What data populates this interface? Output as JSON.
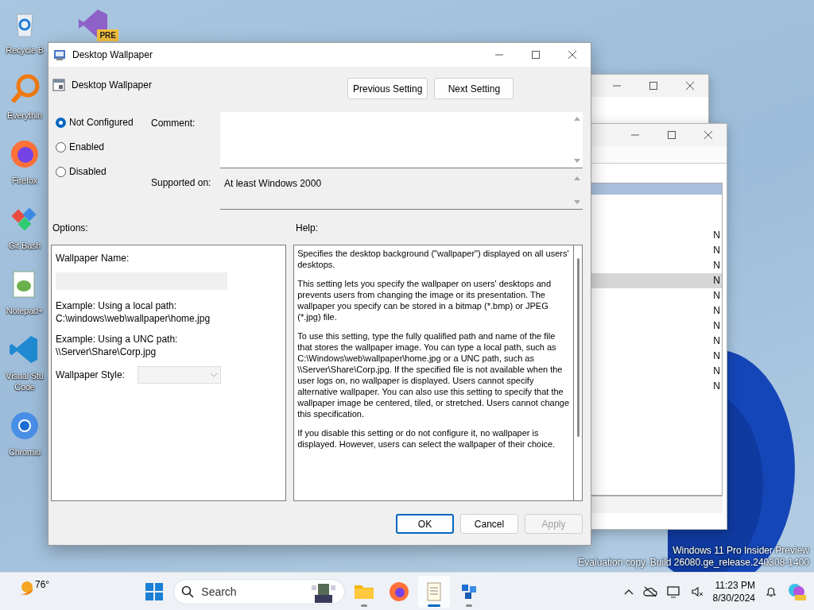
{
  "desktop_columns": [
    [
      {
        "kind": "recycle-bin",
        "label_lines": [
          "Recycle B"
        ]
      },
      {
        "kind": "magnifier-app",
        "label_lines": [
          "Everythin"
        ]
      },
      {
        "kind": "firefox",
        "label_lines": [
          "Firefox"
        ]
      },
      {
        "kind": "git",
        "label_lines": [
          "Git Bash"
        ]
      },
      {
        "kind": "notepad",
        "label_lines": [
          "Notepad+"
        ]
      },
      {
        "kind": "vscode",
        "label_lines": [
          "Visual Stu",
          "Code"
        ]
      },
      {
        "kind": "chromium",
        "label_lines": [
          "Chromiu"
        ]
      }
    ],
    [
      {
        "kind": "visual-studio",
        "badge": "PRE"
      }
    ]
  ],
  "background_windows": [
    {
      "kind": "plain"
    },
    {
      "kind": "list",
      "rows": [
        {
          "cell": "N",
          "selected": false
        },
        {
          "cell": "N",
          "selected": false
        },
        {
          "cell": "N",
          "selected": false
        },
        {
          "cell": "N",
          "selected": true
        },
        {
          "cell": "N",
          "selected": false
        },
        {
          "cell": "N",
          "selected": false
        },
        {
          "cell": "N",
          "selected": false
        },
        {
          "cell": "N",
          "selected": false
        },
        {
          "cell": "N",
          "selected": false
        },
        {
          "cell": "N",
          "selected": false
        },
        {
          "cell": "N",
          "selected": false
        }
      ]
    }
  ],
  "dialog": {
    "title": "Desktop Wallpaper",
    "policy_name": "Desktop Wallpaper",
    "nav_buttons": [
      "Previous Setting",
      "Next Setting"
    ],
    "states": [
      {
        "label": "Not Configured",
        "selected": true
      },
      {
        "label": "Enabled",
        "selected": false
      },
      {
        "label": "Disabled",
        "selected": false
      }
    ],
    "comment_label": "Comment:",
    "supported_label": "Supported on:",
    "supported_value": "At least Windows 2000",
    "options_label": "Options:",
    "help_label": "Help:",
    "options": [
      {
        "kind": "label",
        "text": "Wallpaper Name:"
      },
      {
        "kind": "text_field",
        "disabled": true
      },
      {
        "kind": "note",
        "lines": [
          "Example: Using a local path:",
          "C:\\windows\\web\\wallpaper\\home.jpg"
        ]
      },
      {
        "kind": "note",
        "lines": [
          "Example: Using a UNC path:",
          "\\\\Server\\Share\\Corp.jpg"
        ]
      },
      {
        "kind": "dropdown",
        "label": "Wallpaper Style:",
        "disabled": true
      }
    ],
    "help": [
      "Specifies the desktop background (\"wallpaper\") displayed on all users' desktops.",
      "This setting lets you specify the wallpaper on users' desktops and prevents users from changing the image or its presentation. The wallpaper you specify can be stored in a bitmap (*.bmp) or JPEG (*.jpg) file.",
      "To use this setting, type the fully qualified path and name of the file that stores the wallpaper image. You can type a local path, such as C:\\Windows\\web\\wallpaper\\home.jpg or a UNC path, such as \\\\Server\\Share\\Corp.jpg. If the specified file is not available when the user logs on, no wallpaper is displayed. Users cannot specify alternative wallpaper. You can also use this setting to specify that the wallpaper image be centered, tiled, or stretched. Users cannot change this specification.",
      "If you disable this setting or do not configure it, no wallpaper is displayed. However, users can select the wallpaper of their choice."
    ],
    "buttons": [
      {
        "label": "OK",
        "default": true,
        "disabled": false
      },
      {
        "label": "Cancel",
        "default": false,
        "disabled": false
      },
      {
        "label": "Apply",
        "default": false,
        "disabled": true
      }
    ]
  },
  "watermark": [
    "Windows 11 Pro Insider Preview",
    "Evaluation copy. Build 26080.ge_release.240308-1400"
  ],
  "taskbar": {
    "weather": "76°",
    "search_placeholder": "Search",
    "apps": [
      {
        "kind": "folder",
        "running": true,
        "selected": false
      },
      {
        "kind": "firefox",
        "running": false,
        "selected": false
      },
      {
        "kind": "notepad",
        "running": true,
        "selected": true
      },
      {
        "kind": "cube-app",
        "running": true,
        "selected": false
      }
    ],
    "time": "11:23 PM",
    "date": "8/30/2024"
  }
}
